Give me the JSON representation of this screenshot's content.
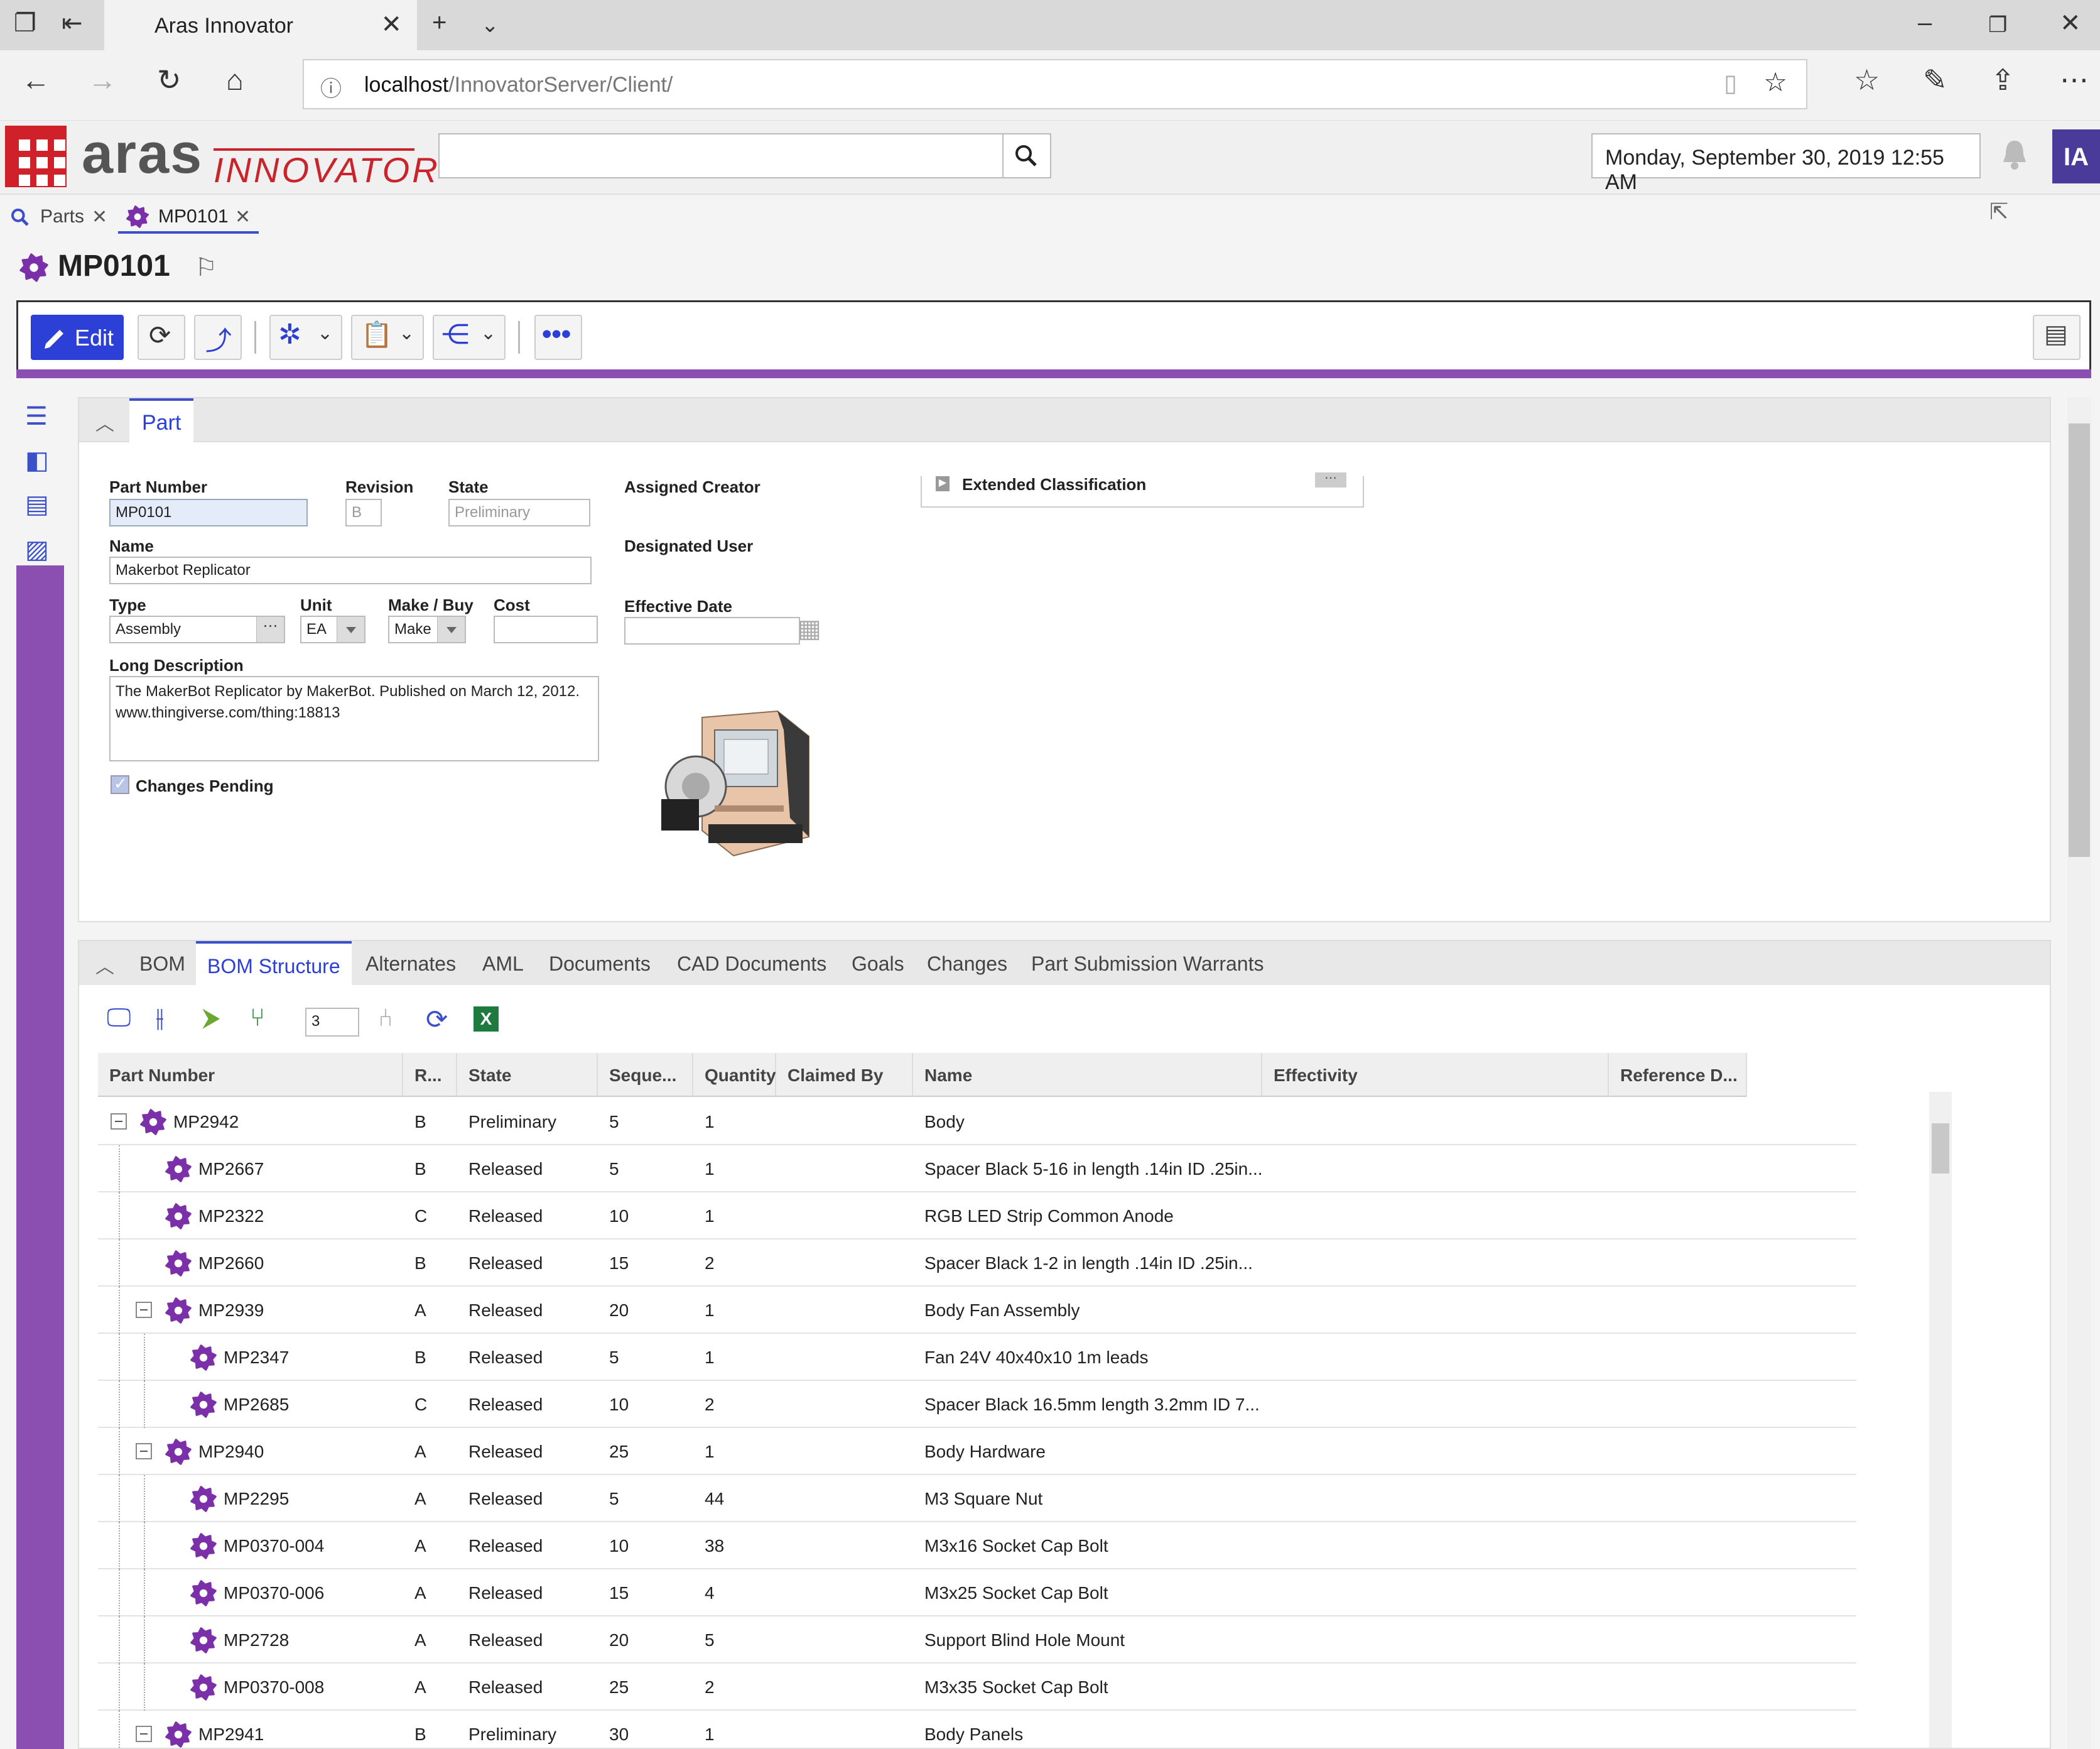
{
  "browser": {
    "tab_title": "Aras Innovator",
    "url_host": "localhost",
    "url_path": "/InnovatorServer/Client/"
  },
  "header": {
    "logo_aras": "aras",
    "logo_innovator": "INNOVATOR",
    "search_placeholder": "",
    "datetime": "Monday, September 30, 2019 12:55 AM",
    "user_initials": "IA"
  },
  "app_tabs": [
    {
      "label": "Parts",
      "icon": "search-icon"
    },
    {
      "label": "MP0101",
      "icon": "gear-icon"
    }
  ],
  "item": {
    "title": "MP0101"
  },
  "toolbar": {
    "edit_label": "Edit"
  },
  "form": {
    "tab_label": "Part",
    "part_number_label": "Part Number",
    "part_number": "MP0101",
    "revision_label": "Revision",
    "revision": "B",
    "state_label": "State",
    "state": "Preliminary",
    "assigned_creator_label": "Assigned Creator",
    "designated_user_label": "Designated User",
    "effective_date_label": "Effective Date",
    "extended_classification_label": "Extended Classification",
    "name_label": "Name",
    "name": "Makerbot Replicator",
    "type_label": "Type",
    "type": "Assembly",
    "unit_label": "Unit",
    "unit": "EA",
    "make_buy_label": "Make / Buy",
    "make_buy": "Make",
    "cost_label": "Cost",
    "cost": "",
    "long_description_label": "Long Description",
    "long_description": "The MakerBot Replicator by MakerBot. Published on March 12, 2012. www.thingiverse.com/thing:18813",
    "changes_pending_label": "Changes Pending",
    "changes_pending": true
  },
  "relationships": {
    "tabs": [
      "BOM",
      "BOM Structure",
      "Alternates",
      "AML",
      "Documents",
      "CAD Documents",
      "Goals",
      "Changes",
      "Part Submission Warrants"
    ],
    "active_tab": "BOM Structure",
    "levels_value": "3",
    "columns": [
      "Part Number",
      "R...",
      "State",
      "Seque...",
      "Quantity",
      "Claimed By",
      "Name",
      "Effectivity",
      "Reference D..."
    ],
    "rows": [
      {
        "level": 0,
        "expanded": true,
        "part_number": "MP2942",
        "rev": "B",
        "state": "Preliminary",
        "seq": "5",
        "qty": "1",
        "name": "Body"
      },
      {
        "level": 1,
        "expanded": null,
        "part_number": "MP2667",
        "rev": "B",
        "state": "Released",
        "seq": "5",
        "qty": "1",
        "name": "Spacer Black 5-16 in length .14in ID .25in..."
      },
      {
        "level": 1,
        "expanded": null,
        "part_number": "MP2322",
        "rev": "C",
        "state": "Released",
        "seq": "10",
        "qty": "1",
        "name": "RGB LED Strip Common Anode"
      },
      {
        "level": 1,
        "expanded": null,
        "part_number": "MP2660",
        "rev": "B",
        "state": "Released",
        "seq": "15",
        "qty": "2",
        "name": "Spacer Black 1-2 in length .14in ID .25in..."
      },
      {
        "level": 1,
        "expanded": true,
        "part_number": "MP2939",
        "rev": "A",
        "state": "Released",
        "seq": "20",
        "qty": "1",
        "name": "Body Fan Assembly"
      },
      {
        "level": 2,
        "expanded": null,
        "part_number": "MP2347",
        "rev": "B",
        "state": "Released",
        "seq": "5",
        "qty": "1",
        "name": "Fan 24V 40x40x10 1m leads"
      },
      {
        "level": 2,
        "expanded": null,
        "part_number": "MP2685",
        "rev": "C",
        "state": "Released",
        "seq": "10",
        "qty": "2",
        "name": "Spacer Black 16.5mm length 3.2mm ID 7..."
      },
      {
        "level": 1,
        "expanded": true,
        "part_number": "MP2940",
        "rev": "A",
        "state": "Released",
        "seq": "25",
        "qty": "1",
        "name": "Body Hardware"
      },
      {
        "level": 2,
        "expanded": null,
        "part_number": "MP2295",
        "rev": "A",
        "state": "Released",
        "seq": "5",
        "qty": "44",
        "name": "M3 Square Nut"
      },
      {
        "level": 2,
        "expanded": null,
        "part_number": "MP0370-004",
        "rev": "A",
        "state": "Released",
        "seq": "10",
        "qty": "38",
        "name": "M3x16 Socket Cap Bolt"
      },
      {
        "level": 2,
        "expanded": null,
        "part_number": "MP0370-006",
        "rev": "A",
        "state": "Released",
        "seq": "15",
        "qty": "4",
        "name": "M3x25 Socket Cap Bolt"
      },
      {
        "level": 2,
        "expanded": null,
        "part_number": "MP2728",
        "rev": "A",
        "state": "Released",
        "seq": "20",
        "qty": "5",
        "name": "Support Blind Hole Mount"
      },
      {
        "level": 2,
        "expanded": null,
        "part_number": "MP0370-008",
        "rev": "A",
        "state": "Released",
        "seq": "25",
        "qty": "2",
        "name": "M3x35 Socket Cap Bolt"
      },
      {
        "level": 1,
        "expanded": true,
        "part_number": "MP2941",
        "rev": "B",
        "state": "Preliminary",
        "seq": "30",
        "qty": "1",
        "name": "Body Panels"
      }
    ]
  },
  "colors": {
    "brand_red": "#d0202a",
    "accent_purple": "#8a4fb0",
    "gear_purple": "#7b2fa8",
    "edit_blue": "#2c40d8"
  }
}
